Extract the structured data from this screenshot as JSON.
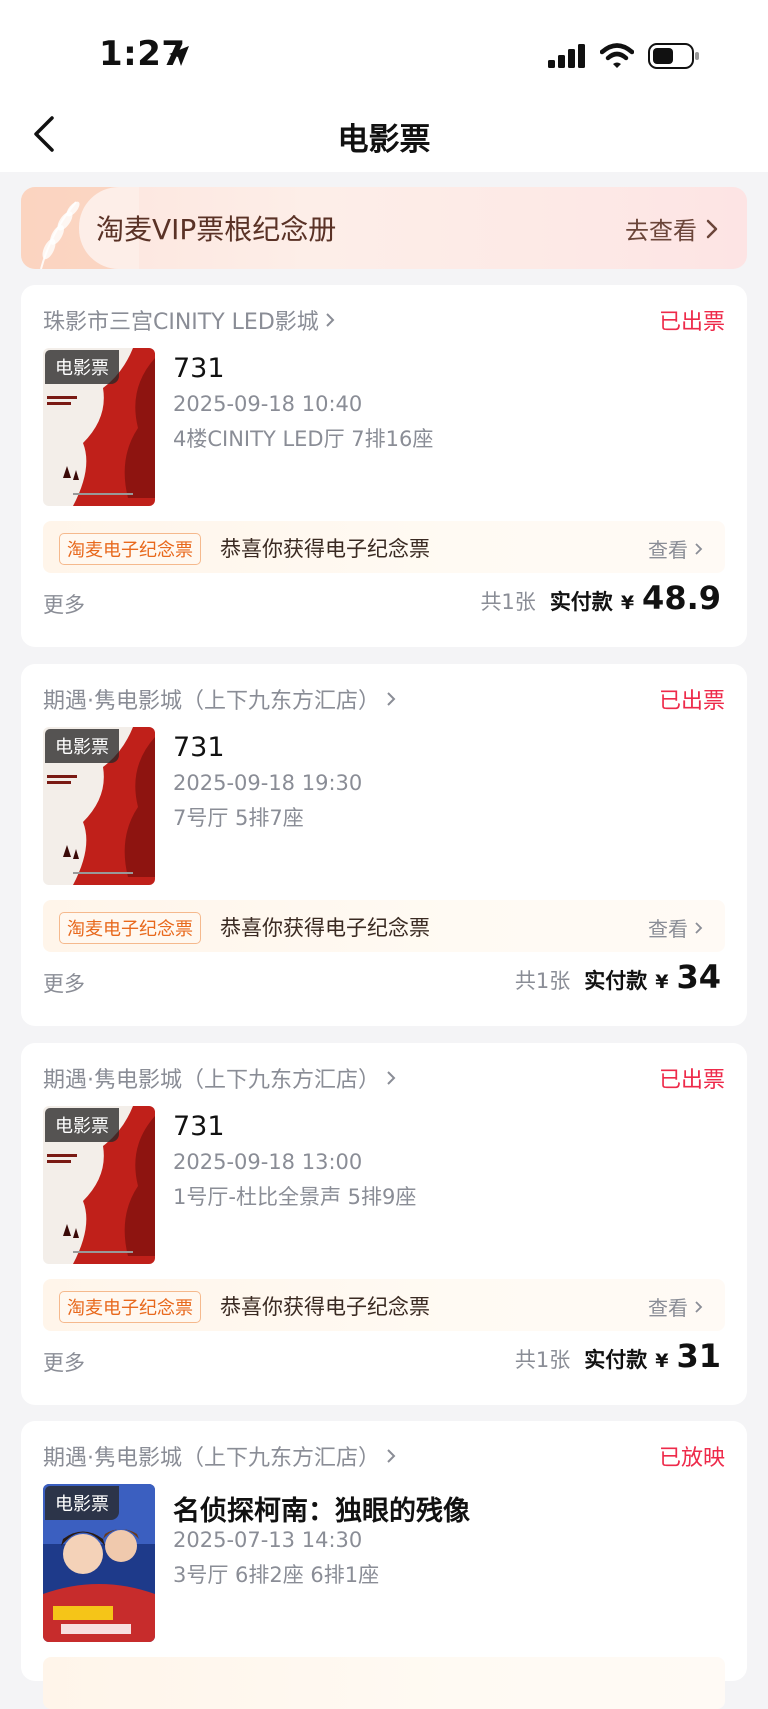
{
  "status_bar": {
    "time": "1:27"
  },
  "nav": {
    "title": "电影票"
  },
  "vip_banner": {
    "title": "淘麦VIP票根纪念册",
    "link": "去查看"
  },
  "orders": [
    {
      "cinema": "珠影市三宫CINITY LED影城",
      "status": "已出票",
      "poster_tag": "电影票",
      "movie": "731",
      "datetime": "2025-09-18 10:40",
      "hall": "4楼CINITY LED厅 7排16座",
      "memento_tag": "淘麦电子纪念票",
      "memento_text": "恭喜你获得电子纪念票",
      "memento_link": "查看",
      "more": "更多",
      "qty": "共1张",
      "paid_label": "实付款",
      "currency": "¥",
      "amount": "48.9"
    },
    {
      "cinema": "期遇·隽电影城（上下九东方汇店）",
      "status": "已出票",
      "poster_tag": "电影票",
      "movie": "731",
      "datetime": "2025-09-18 19:30",
      "hall": "7号厅 5排7座",
      "memento_tag": "淘麦电子纪念票",
      "memento_text": "恭喜你获得电子纪念票",
      "memento_link": "查看",
      "more": "更多",
      "qty": "共1张",
      "paid_label": "实付款",
      "currency": "¥",
      "amount": "34"
    },
    {
      "cinema": "期遇·隽电影城（上下九东方汇店）",
      "status": "已出票",
      "poster_tag": "电影票",
      "movie": "731",
      "datetime": "2025-09-18 13:00",
      "hall": "1号厅-杜比全景声 5排9座",
      "memento_tag": "淘麦电子纪念票",
      "memento_text": "恭喜你获得电子纪念票",
      "memento_link": "查看",
      "more": "更多",
      "qty": "共1张",
      "paid_label": "实付款",
      "currency": "¥",
      "amount": "31"
    },
    {
      "cinema": "期遇·隽电影城（上下九东方汇店）",
      "status": "已放映",
      "poster_tag": "电影票",
      "movie": "名侦探柯南：独眼的残像",
      "datetime": "2025-07-13 14:30",
      "hall": "3号厅 6排2座 6排1座"
    }
  ],
  "colors": {
    "status_red": "#ee2a4a",
    "memento_orange": "#e8691d",
    "poster_red": "#c0201a"
  },
  "icons": [
    "location-arrow-icon",
    "signal-icon",
    "wifi-icon",
    "battery-icon",
    "back-chevron-icon",
    "chevron-right-icon",
    "wheat-deco-icon"
  ]
}
